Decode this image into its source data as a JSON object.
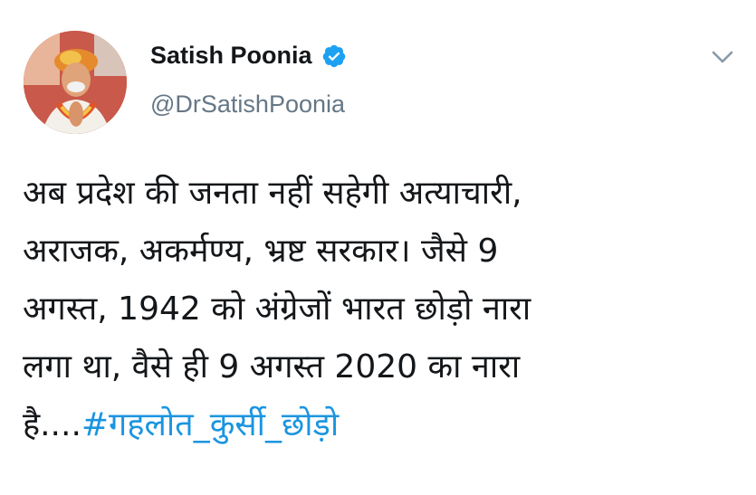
{
  "author": {
    "name": "Satish Poonia",
    "handle": "@DrSatishPoonia",
    "verified": true
  },
  "tweet": {
    "lines": [
      "अब प्रदेश की जनता नहीं सहेगी अत्याचारी,",
      "अराजक, अकर्मण्य, भ्रष्ट सरकार। जैसे 9",
      "अगस्त, 1942 को अंग्रेजों भारत छोड़ो नारा",
      "लगा था, वैसे ही 9 अगस्त 2020 का नारा"
    ],
    "last_line_prefix": "है....",
    "hashtag": "#गहलोत_कुर्सी_छोड़ो"
  },
  "colors": {
    "text": "#14171a",
    "secondary": "#657786",
    "link": "#1b95e0",
    "verified": "#1da1f2"
  },
  "icons": {
    "verified": "verified-badge-icon",
    "menu": "chevron-down-icon"
  }
}
